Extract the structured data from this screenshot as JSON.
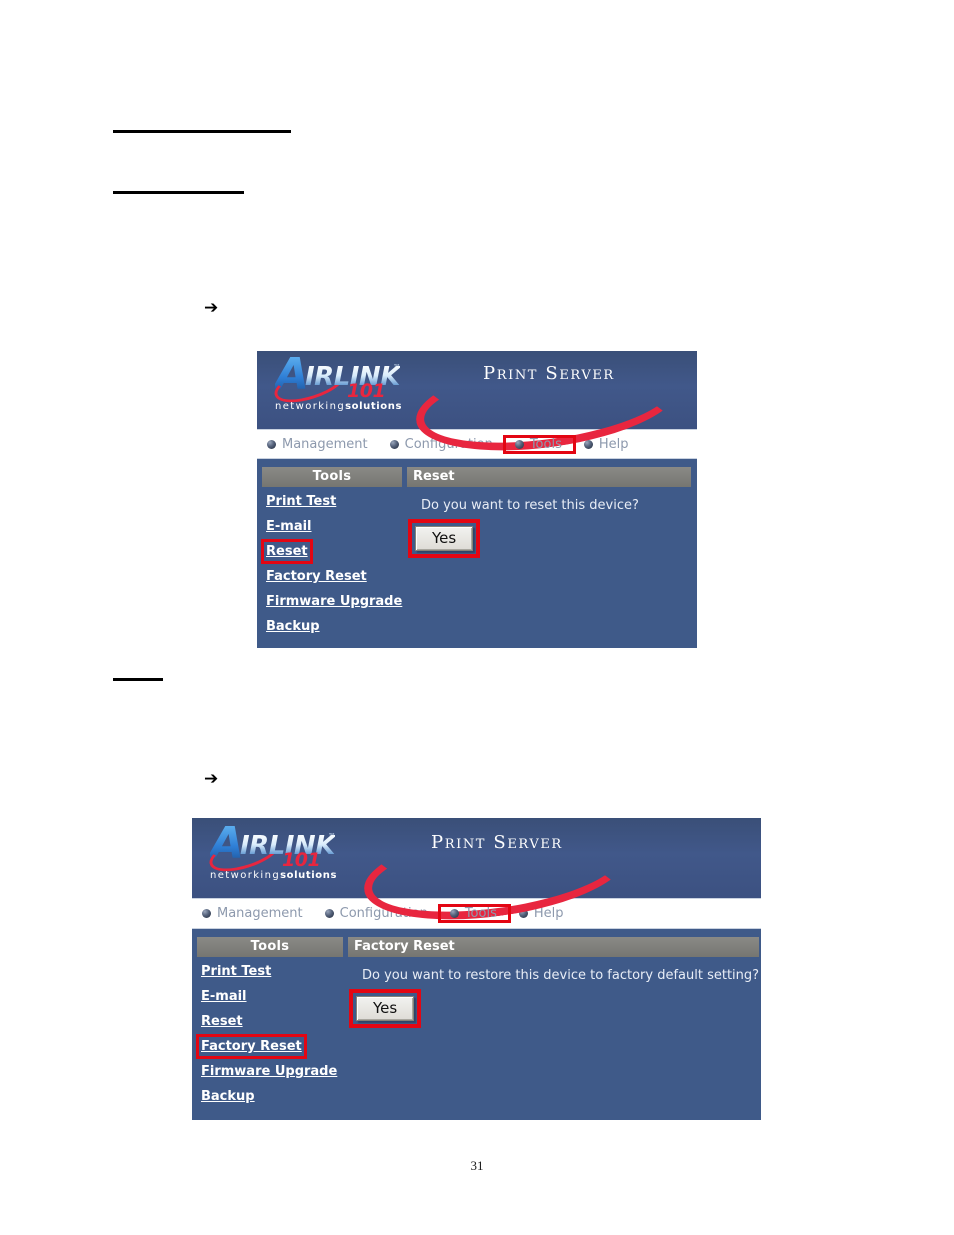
{
  "page": {
    "number": "31",
    "arrow_glyph": "➔"
  },
  "screenshots": [
    {
      "id": "reset",
      "brand": {
        "logo_letter": "A",
        "logo_word": "IRLINK",
        "logo_tm": "™",
        "logo_number": "101",
        "tagline_light": "networking",
        "tagline_bold": "solutions",
        "product": "Print Server"
      },
      "nav": {
        "items": [
          {
            "label": "Management",
            "highlighted": false
          },
          {
            "label": "Configuration",
            "highlighted": false
          },
          {
            "label": "Tools",
            "highlighted": true
          },
          {
            "label": "Help",
            "highlighted": false
          }
        ]
      },
      "sidebar": {
        "title": "Tools",
        "items": [
          {
            "label": "Print Test",
            "highlighted": false
          },
          {
            "label": "E-mail",
            "highlighted": false
          },
          {
            "label": "Reset",
            "highlighted": true
          },
          {
            "label": "Factory Reset",
            "highlighted": false
          },
          {
            "label": "Firmware Upgrade",
            "highlighted": false
          },
          {
            "label": "Backup",
            "highlighted": false
          }
        ]
      },
      "content": {
        "title": "Reset",
        "question": "Do you want to reset this device?",
        "confirm_label": "Yes",
        "confirm_highlighted": true
      }
    },
    {
      "id": "factory-reset",
      "brand": {
        "logo_letter": "A",
        "logo_word": "IRLINK",
        "logo_tm": "™",
        "logo_number": "101",
        "tagline_light": "networking",
        "tagline_bold": "solutions",
        "product": "Print Server"
      },
      "nav": {
        "items": [
          {
            "label": "Management",
            "highlighted": false
          },
          {
            "label": "Configuration",
            "highlighted": false
          },
          {
            "label": "Tools",
            "highlighted": true
          },
          {
            "label": "Help",
            "highlighted": false
          }
        ]
      },
      "sidebar": {
        "title": "Tools",
        "items": [
          {
            "label": "Print Test",
            "highlighted": false
          },
          {
            "label": "E-mail",
            "highlighted": false
          },
          {
            "label": "Reset",
            "highlighted": false
          },
          {
            "label": "Factory Reset",
            "highlighted": true
          },
          {
            "label": "Firmware Upgrade",
            "highlighted": false
          },
          {
            "label": "Backup",
            "highlighted": false
          }
        ]
      },
      "content": {
        "title": "Factory Reset",
        "question": "Do you want to restore this device to factory default setting?",
        "confirm_label": "Yes",
        "confirm_highlighted": true
      }
    }
  ],
  "colors": {
    "panel_body": "#3f5a89",
    "panel_header": "#3a4f78",
    "accent_red": "#e8263f",
    "annotation_red": "#e30613",
    "bar_grey": "#7d7d78",
    "nav_bg": "#ffffff",
    "nav_text": "#8d99ad"
  }
}
